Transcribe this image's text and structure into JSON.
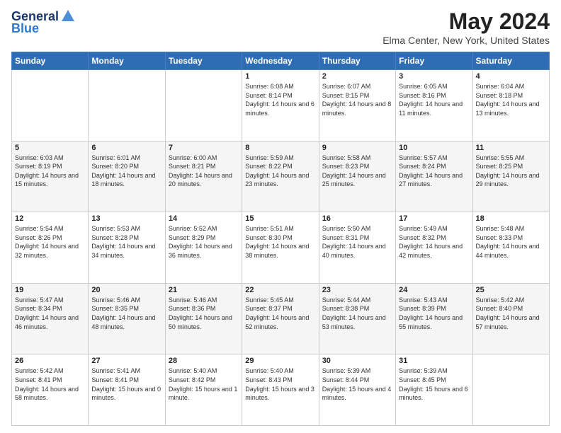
{
  "header": {
    "logo_general": "General",
    "logo_blue": "Blue",
    "month_title": "May 2024",
    "location": "Elma Center, New York, United States"
  },
  "weekdays": [
    "Sunday",
    "Monday",
    "Tuesday",
    "Wednesday",
    "Thursday",
    "Friday",
    "Saturday"
  ],
  "weeks": [
    [
      {
        "day": "",
        "sunrise": "",
        "sunset": "",
        "daylight": ""
      },
      {
        "day": "",
        "sunrise": "",
        "sunset": "",
        "daylight": ""
      },
      {
        "day": "",
        "sunrise": "",
        "sunset": "",
        "daylight": ""
      },
      {
        "day": "1",
        "sunrise": "Sunrise: 6:08 AM",
        "sunset": "Sunset: 8:14 PM",
        "daylight": "Daylight: 14 hours and 6 minutes."
      },
      {
        "day": "2",
        "sunrise": "Sunrise: 6:07 AM",
        "sunset": "Sunset: 8:15 PM",
        "daylight": "Daylight: 14 hours and 8 minutes."
      },
      {
        "day": "3",
        "sunrise": "Sunrise: 6:05 AM",
        "sunset": "Sunset: 8:16 PM",
        "daylight": "Daylight: 14 hours and 11 minutes."
      },
      {
        "day": "4",
        "sunrise": "Sunrise: 6:04 AM",
        "sunset": "Sunset: 8:18 PM",
        "daylight": "Daylight: 14 hours and 13 minutes."
      }
    ],
    [
      {
        "day": "5",
        "sunrise": "Sunrise: 6:03 AM",
        "sunset": "Sunset: 8:19 PM",
        "daylight": "Daylight: 14 hours and 15 minutes."
      },
      {
        "day": "6",
        "sunrise": "Sunrise: 6:01 AM",
        "sunset": "Sunset: 8:20 PM",
        "daylight": "Daylight: 14 hours and 18 minutes."
      },
      {
        "day": "7",
        "sunrise": "Sunrise: 6:00 AM",
        "sunset": "Sunset: 8:21 PM",
        "daylight": "Daylight: 14 hours and 20 minutes."
      },
      {
        "day": "8",
        "sunrise": "Sunrise: 5:59 AM",
        "sunset": "Sunset: 8:22 PM",
        "daylight": "Daylight: 14 hours and 23 minutes."
      },
      {
        "day": "9",
        "sunrise": "Sunrise: 5:58 AM",
        "sunset": "Sunset: 8:23 PM",
        "daylight": "Daylight: 14 hours and 25 minutes."
      },
      {
        "day": "10",
        "sunrise": "Sunrise: 5:57 AM",
        "sunset": "Sunset: 8:24 PM",
        "daylight": "Daylight: 14 hours and 27 minutes."
      },
      {
        "day": "11",
        "sunrise": "Sunrise: 5:55 AM",
        "sunset": "Sunset: 8:25 PM",
        "daylight": "Daylight: 14 hours and 29 minutes."
      }
    ],
    [
      {
        "day": "12",
        "sunrise": "Sunrise: 5:54 AM",
        "sunset": "Sunset: 8:26 PM",
        "daylight": "Daylight: 14 hours and 32 minutes."
      },
      {
        "day": "13",
        "sunrise": "Sunrise: 5:53 AM",
        "sunset": "Sunset: 8:28 PM",
        "daylight": "Daylight: 14 hours and 34 minutes."
      },
      {
        "day": "14",
        "sunrise": "Sunrise: 5:52 AM",
        "sunset": "Sunset: 8:29 PM",
        "daylight": "Daylight: 14 hours and 36 minutes."
      },
      {
        "day": "15",
        "sunrise": "Sunrise: 5:51 AM",
        "sunset": "Sunset: 8:30 PM",
        "daylight": "Daylight: 14 hours and 38 minutes."
      },
      {
        "day": "16",
        "sunrise": "Sunrise: 5:50 AM",
        "sunset": "Sunset: 8:31 PM",
        "daylight": "Daylight: 14 hours and 40 minutes."
      },
      {
        "day": "17",
        "sunrise": "Sunrise: 5:49 AM",
        "sunset": "Sunset: 8:32 PM",
        "daylight": "Daylight: 14 hours and 42 minutes."
      },
      {
        "day": "18",
        "sunrise": "Sunrise: 5:48 AM",
        "sunset": "Sunset: 8:33 PM",
        "daylight": "Daylight: 14 hours and 44 minutes."
      }
    ],
    [
      {
        "day": "19",
        "sunrise": "Sunrise: 5:47 AM",
        "sunset": "Sunset: 8:34 PM",
        "daylight": "Daylight: 14 hours and 46 minutes."
      },
      {
        "day": "20",
        "sunrise": "Sunrise: 5:46 AM",
        "sunset": "Sunset: 8:35 PM",
        "daylight": "Daylight: 14 hours and 48 minutes."
      },
      {
        "day": "21",
        "sunrise": "Sunrise: 5:46 AM",
        "sunset": "Sunset: 8:36 PM",
        "daylight": "Daylight: 14 hours and 50 minutes."
      },
      {
        "day": "22",
        "sunrise": "Sunrise: 5:45 AM",
        "sunset": "Sunset: 8:37 PM",
        "daylight": "Daylight: 14 hours and 52 minutes."
      },
      {
        "day": "23",
        "sunrise": "Sunrise: 5:44 AM",
        "sunset": "Sunset: 8:38 PM",
        "daylight": "Daylight: 14 hours and 53 minutes."
      },
      {
        "day": "24",
        "sunrise": "Sunrise: 5:43 AM",
        "sunset": "Sunset: 8:39 PM",
        "daylight": "Daylight: 14 hours and 55 minutes."
      },
      {
        "day": "25",
        "sunrise": "Sunrise: 5:42 AM",
        "sunset": "Sunset: 8:40 PM",
        "daylight": "Daylight: 14 hours and 57 minutes."
      }
    ],
    [
      {
        "day": "26",
        "sunrise": "Sunrise: 5:42 AM",
        "sunset": "Sunset: 8:41 PM",
        "daylight": "Daylight: 14 hours and 58 minutes."
      },
      {
        "day": "27",
        "sunrise": "Sunrise: 5:41 AM",
        "sunset": "Sunset: 8:41 PM",
        "daylight": "Daylight: 15 hours and 0 minutes."
      },
      {
        "day": "28",
        "sunrise": "Sunrise: 5:40 AM",
        "sunset": "Sunset: 8:42 PM",
        "daylight": "Daylight: 15 hours and 1 minute."
      },
      {
        "day": "29",
        "sunrise": "Sunrise: 5:40 AM",
        "sunset": "Sunset: 8:43 PM",
        "daylight": "Daylight: 15 hours and 3 minutes."
      },
      {
        "day": "30",
        "sunrise": "Sunrise: 5:39 AM",
        "sunset": "Sunset: 8:44 PM",
        "daylight": "Daylight: 15 hours and 4 minutes."
      },
      {
        "day": "31",
        "sunrise": "Sunrise: 5:39 AM",
        "sunset": "Sunset: 8:45 PM",
        "daylight": "Daylight: 15 hours and 6 minutes."
      },
      {
        "day": "",
        "sunrise": "",
        "sunset": "",
        "daylight": ""
      }
    ]
  ]
}
